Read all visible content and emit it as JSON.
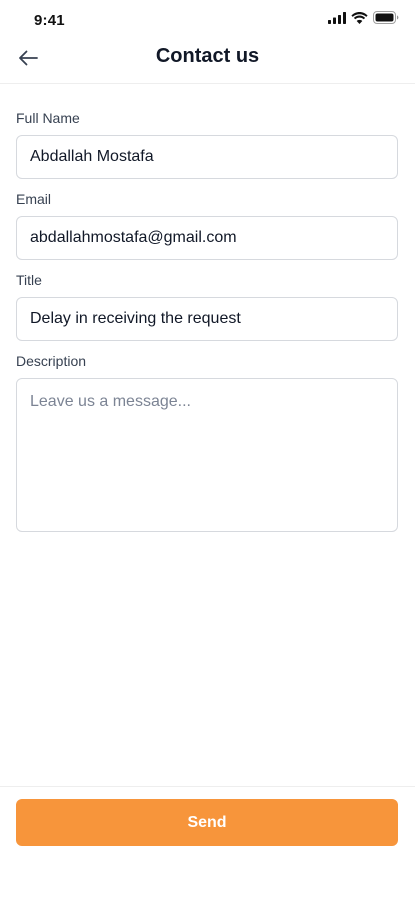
{
  "status_bar": {
    "time": "9:41",
    "icons": [
      "cellular-signal-icon",
      "wifi-icon",
      "battery-icon"
    ]
  },
  "header": {
    "title": "Contact us",
    "back_icon": "arrow-left-icon"
  },
  "form": {
    "full_name": {
      "label": "Full Name",
      "value": "Abdallah Mostafa"
    },
    "email": {
      "label": "Email",
      "value": "abdallahmostafa@gmail.com"
    },
    "title": {
      "label": "Title",
      "value": "Delay in receiving the request"
    },
    "description": {
      "label": "Description",
      "value": "",
      "placeholder": "Leave us a message..."
    }
  },
  "footer": {
    "send_label": "Send"
  },
  "colors": {
    "accent": "#f7953b",
    "input_border": "#d6d9de",
    "title_text": "#111827",
    "label_text": "#374151",
    "placeholder_text": "#7c8494"
  }
}
